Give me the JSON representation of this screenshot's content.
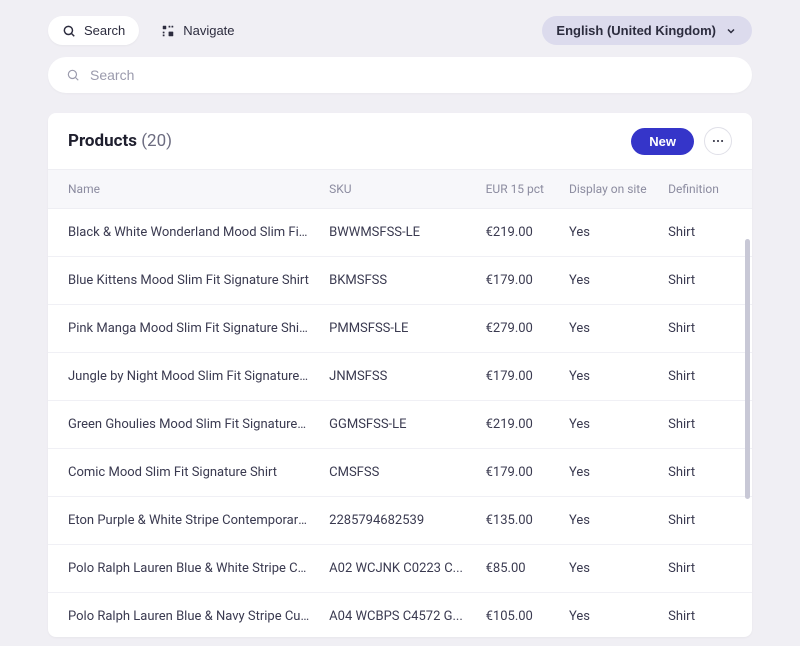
{
  "topbar": {
    "search_label": "Search",
    "navigate_label": "Navigate",
    "language_label": "English (United Kingdom)"
  },
  "search": {
    "placeholder": "Search"
  },
  "header": {
    "title": "Products",
    "count": "(20)",
    "new_label": "New"
  },
  "table": {
    "columns": {
      "name": "Name",
      "sku": "SKU",
      "price": "EUR 15 pct",
      "display": "Display on site",
      "definition": "Definition"
    },
    "rows": [
      {
        "name": "Black & White Wonderland Mood Slim Fit Signature Shirt",
        "sku": "BWWMSFSS-LE",
        "price": "€219.00",
        "display": "Yes",
        "definition": "Shirt"
      },
      {
        "name": "Blue Kittens Mood Slim Fit Signature Shirt",
        "sku": "BKMSFSS",
        "price": "€179.00",
        "display": "Yes",
        "definition": "Shirt"
      },
      {
        "name": "Pink Manga Mood Slim Fit Signature Shirt - Limited",
        "sku": "PMMSFSS-LE",
        "price": "€279.00",
        "display": "Yes",
        "definition": "Shirt"
      },
      {
        "name": "Jungle by Night Mood Slim Fit Signature Shirt",
        "sku": "JNMSFSS",
        "price": "€179.00",
        "display": "Yes",
        "definition": "Shirt"
      },
      {
        "name": "Green Ghoulies Mood Slim Fit Signature Shirt",
        "sku": "GGMSFSS-LE",
        "price": "€219.00",
        "display": "Yes",
        "definition": "Shirt"
      },
      {
        "name": "Comic Mood Slim Fit Signature Shirt",
        "sku": "CMSFSS",
        "price": "€179.00",
        "display": "Yes",
        "definition": "Shirt"
      },
      {
        "name": "Eton Purple & White Stripe Contemporary Fit Shirt",
        "sku": "2285794682539",
        "price": "€135.00",
        "display": "Yes",
        "definition": "Shirt"
      },
      {
        "name": "Polo Ralph Lauren Blue & White Stripe Custom Fit",
        "sku": "A02 WCJNK C0223 C...",
        "price": "€85.00",
        "display": "Yes",
        "definition": "Shirt"
      },
      {
        "name": "Polo Ralph Lauren Blue & Navy Stripe Custom Fit",
        "sku": "A04 WCBPS C4572 G...",
        "price": "€105.00",
        "display": "Yes",
        "definition": "Shirt"
      }
    ]
  }
}
